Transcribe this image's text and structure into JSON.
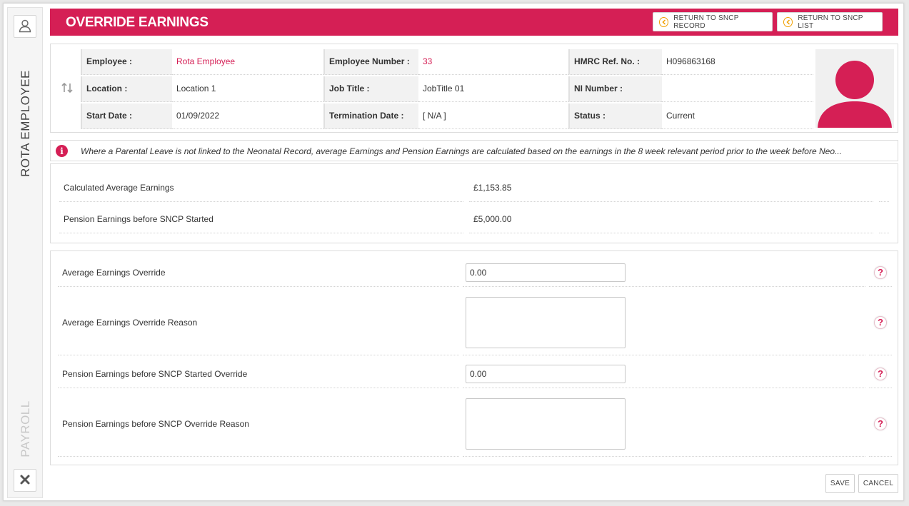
{
  "sidebar": {
    "employee_label": "ROTA EMPLOYEE",
    "module_label": "PAYROLL",
    "top_icon": "user-icon",
    "bottom_icon": "close-icon"
  },
  "header": {
    "title": "OVERRIDE EARNINGS",
    "return_record_label": "RETURN TO SNCP RECORD",
    "return_list_label": "RETURN TO SNCP LIST"
  },
  "employee": {
    "rows": [
      {
        "l1": "Employee :",
        "v1": "Rota Employee",
        "l2": "Employee Number :",
        "v2": "33",
        "l3": "HMRC Ref. No. :",
        "v3": "H096863168"
      },
      {
        "l1": "Location :",
        "v1": "Location 1",
        "l2": "Job Title :",
        "v2": "JobTitle 01",
        "l3": "NI Number :",
        "v3": ""
      },
      {
        "l1": "Start Date :",
        "v1": "01/09/2022",
        "l2": "Termination Date :",
        "v2": "[ N/A ]",
        "l3": "Status :",
        "v3": "Current"
      }
    ]
  },
  "info": {
    "text": "Where a Parental Leave is not linked to the Neonatal Record, average Earnings and Pension Earnings are calculated based on the earnings in the 8 week relevant period prior to the week before Neo..."
  },
  "calculated": {
    "avg_label": "Calculated Average Earnings",
    "avg_value": "£1,153.85",
    "pension_label": "Pension Earnings before SNCP Started",
    "pension_value": "£5,000.00"
  },
  "form": {
    "avg_override_label": "Average Earnings Override",
    "avg_override_value": "0.00",
    "avg_reason_label": "Average Earnings Override Reason",
    "pension_override_label": "Pension Earnings before SNCP Started Override",
    "pension_override_value": "0.00",
    "pension_reason_label": "Pension Earnings before SNCP Override Reason"
  },
  "footer": {
    "save_label": "SAVE",
    "cancel_label": "CANCEL"
  },
  "colors": {
    "brand": "#d51f55",
    "accent_orange": "#f0a000"
  }
}
